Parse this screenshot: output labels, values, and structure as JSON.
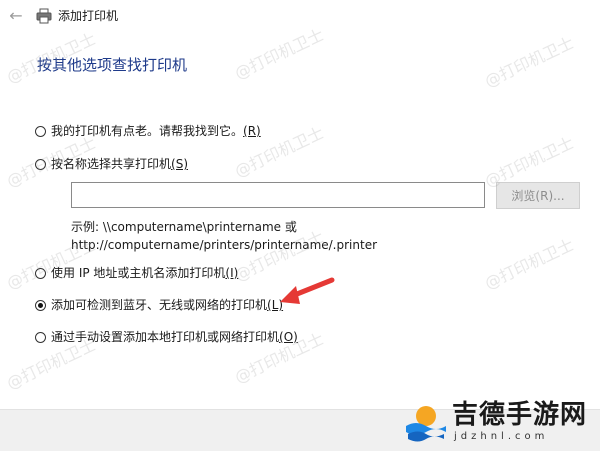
{
  "window": {
    "title": "添加打印机"
  },
  "page": {
    "heading": "按其他选项查找打印机"
  },
  "options": [
    {
      "label": "我的打印机有点老。请帮我找到它。",
      "hotkey": "(R)",
      "checked": false
    },
    {
      "label": "按名称选择共享打印机",
      "hotkey": "(S)",
      "checked": false
    },
    {
      "label": "使用 IP 地址或主机名添加打印机",
      "hotkey": "(I)",
      "checked": false
    },
    {
      "label": "添加可检测到蓝牙、无线或网络的打印机",
      "hotkey": "(L)",
      "checked": true
    },
    {
      "label": "通过手动设置添加本地打印机或网络打印机",
      "hotkey": "(O)",
      "checked": false
    }
  ],
  "share": {
    "input_value": "",
    "browse_label": "浏览(R)...",
    "example_line1": "示例: \\\\computername\\printername 或",
    "example_line2": "http://computername/printers/printername/.printer"
  },
  "watermark": {
    "text": "@打印机卫士"
  },
  "logo": {
    "name": "吉德手游网",
    "url": "jdzhnl.com"
  },
  "colors": {
    "heading": "#1e3a8a",
    "arrow": "#e53935",
    "footer": "#f0f0f0"
  },
  "icons": {
    "back": "back-arrow-icon",
    "printer": "printer-icon"
  }
}
